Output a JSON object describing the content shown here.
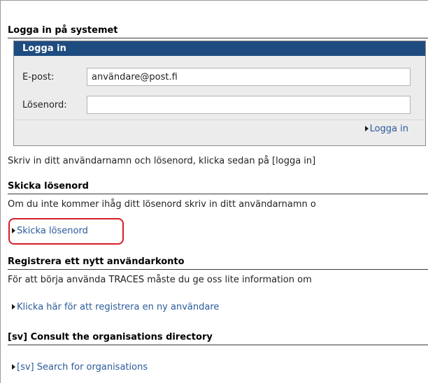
{
  "login_section": {
    "title": "Logga in på systemet"
  },
  "login_panel": {
    "header": "Logga in",
    "email_label": "E-post:",
    "email_value": "användare@post.fi",
    "password_label": "Lösenord:",
    "password_value": "",
    "login_link": "Logga in"
  },
  "login_help": "Skriv in ditt användarnamn och lösenord, klicka sedan på [logga in]",
  "password_section": {
    "title": "Skicka lösenord",
    "text": "Om du inte kommer ihåg ditt lösenord skriv in ditt användarnamn o",
    "link": "Skicka lösenord"
  },
  "register_section": {
    "title": "Registrera ett nytt användarkonto",
    "text": "För att börja använda TRACES måste du ge oss lite information om",
    "link": "Klicka här för att registrera en ny användare"
  },
  "directory_section": {
    "title": "[sv] Consult the organisations directory",
    "link": "[sv] Search for organisations"
  },
  "colors": {
    "panel_header": "#1f4c80",
    "link": "#2a5a9a",
    "highlight": "#d61f26"
  }
}
